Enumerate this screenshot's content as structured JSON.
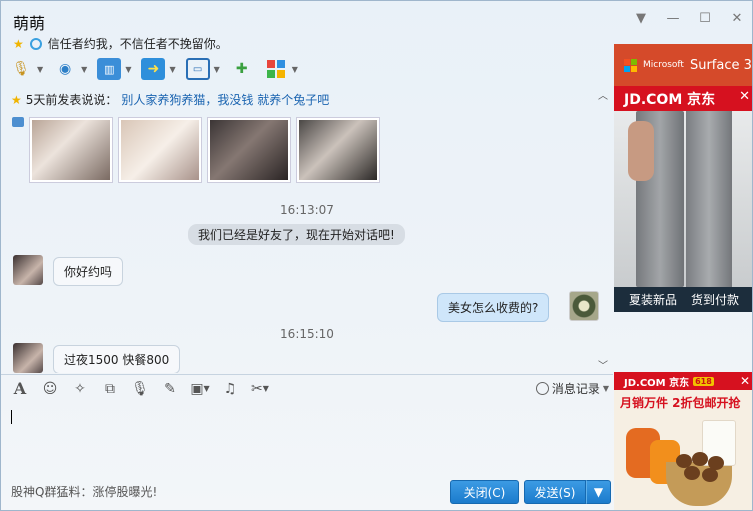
{
  "window": {
    "title": "萌萌",
    "signature": "信任者约我，不信任者不挽留你。",
    "controls": [
      "chevron-down-icon",
      "minimize-icon",
      "maximize-icon",
      "close-icon"
    ]
  },
  "toolbar": {
    "items": [
      "voice-call-icon",
      "video-call-icon",
      "remote-assist-icon",
      "send-file-icon",
      "screen-share-icon",
      "create-discussion-icon",
      "apps-icon"
    ]
  },
  "chat": {
    "status_prefix": "5天前发表说说：",
    "status_link": "别人家养狗养猫，我没钱 就养个兔子吧",
    "messages": [
      {
        "type": "time",
        "text": "16:13:07"
      },
      {
        "type": "system",
        "text": "我们已经是好友了，现在开始对话吧!"
      },
      {
        "type": "incoming",
        "text": "你好约吗"
      },
      {
        "type": "outgoing",
        "text": "美女怎么收费的?"
      },
      {
        "type": "time",
        "text": "16:15:10"
      },
      {
        "type": "incoming",
        "text": "过夜1500 快餐800"
      }
    ]
  },
  "input": {
    "tools": [
      "font-icon",
      "emoji-icon",
      "shake-icon",
      "gif-icon",
      "voice-message-icon",
      "edit-icon",
      "image-icon",
      "music-icon",
      "screenshot-icon"
    ],
    "history_label": "消息记录",
    "footer_note": "股神Q群猛料：涨停股曝光!",
    "close_label": "关闭(C)",
    "send_label": "发送(S)"
  },
  "ads": {
    "right_brand": "Microsoft",
    "right_product": "Surface 3",
    "right_store": "JD.COM 京东",
    "right_caption_1": "夏装新品",
    "right_caption_2": "货到付款",
    "bottom_store": "JD.COM 京东",
    "bottom_tag": "618",
    "bottom_promo": "月销万件 2折包邮开抢"
  }
}
